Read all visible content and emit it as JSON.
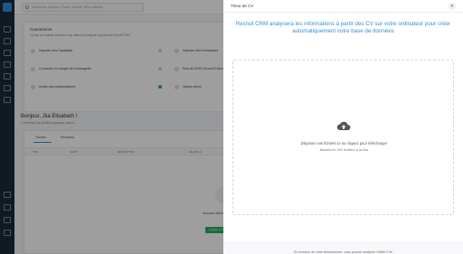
{
  "search": {
    "placeholder": "Recherche par nom, Poste, Courriel, URL Linkedin"
  },
  "onboarding": {
    "title": "Commencer",
    "subtitle": "La liste de contrôle suivante vous aidera à configurer rapidement Recruit CRM.",
    "steps": [
      {
        "label": "Importer des Candidats"
      },
      {
        "label": "Connecter le compte de messagerie"
      },
      {
        "label": "Inviter des collaborateurs"
      },
      {
        "label": "Importer des Entreprises"
      },
      {
        "label": "Recruit CRM Chrome Extension"
      },
      {
        "label": "Vidéos démo"
      }
    ]
  },
  "greeting": {
    "title": "Bonjour, Jiia Elisabeth !",
    "subtitle": "Il est temps de planifier quelques actions"
  },
  "tasks": {
    "tabs": [
      "Tâches",
      "Réunions"
    ],
    "columns": [
      "TYPE",
      "SUJET",
      "DESCRIPTION",
      "RELATIF À"
    ],
    "empty_text": "Aucune tâche en",
    "add_label": "+ Ajouter une tâche"
  },
  "panel": {
    "title": "Trieur de CV",
    "intro": "Recruit CRM analysera les informations à partir des CV sur votre ordinateur pour créer automatiquement votre base de données",
    "drop_main": "Déposez vos fichiers ici ou cliquez pour télécharger",
    "drop_sub": "Maximum 100 fichiers à la fois",
    "footer": "En fonction de votre Abonnement, vous pouvez analyser 19960 CVs",
    "close_glyph": "✕"
  },
  "colors": {
    "accent": "#3a8fd6",
    "rail": "#1b2a3a",
    "success": "#27ae60"
  },
  "icons": [
    "search-icon",
    "upload-cloud-icon",
    "close-icon"
  ]
}
